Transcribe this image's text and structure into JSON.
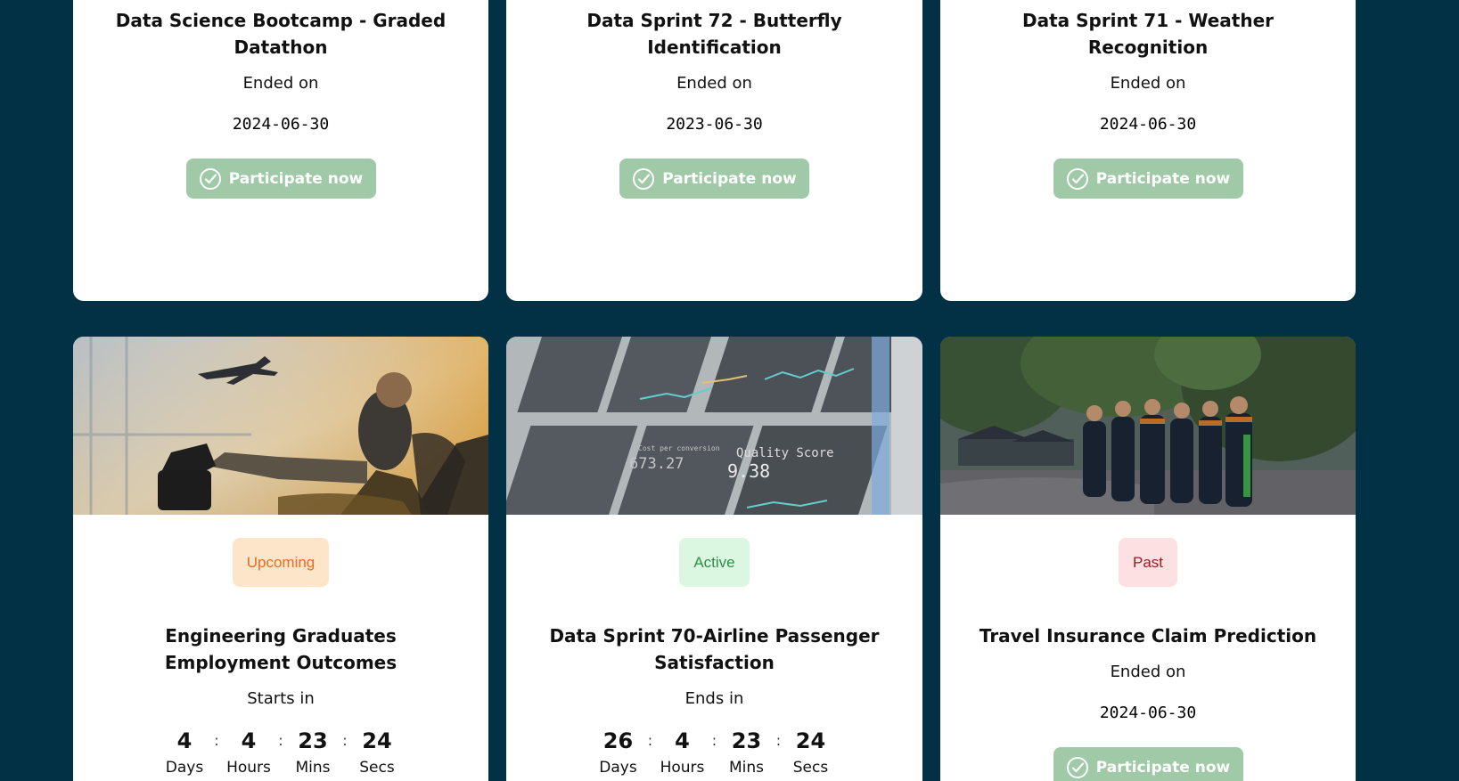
{
  "top_row": [
    {
      "title": "Data Science Bootcamp - Graded Datathon",
      "label": "Ended on",
      "date": "2024-06-30",
      "button": "Participate now"
    },
    {
      "title": "Data Sprint 72 - Butterfly Identification",
      "label": "Ended on",
      "date": "2023-06-30",
      "button": "Participate now"
    },
    {
      "title": "Data Sprint 71 - Weather Recognition",
      "label": "Ended on",
      "date": "2024-06-30",
      "button": "Participate now"
    }
  ],
  "bottom_row": [
    {
      "badge": "Upcoming",
      "title": "Engineering Graduates Employment Outcomes",
      "label": "Starts in",
      "countdown": {
        "days": "4",
        "hours": "4",
        "mins": "23",
        "secs": "24",
        "days_label": "Days",
        "hours_label": "Hours",
        "mins_label": "Mins",
        "secs_label": "Secs"
      }
    },
    {
      "badge": "Active",
      "title": "Data Sprint 70-Airline Passenger Satisfaction",
      "label": "Ends in",
      "countdown": {
        "days": "26",
        "hours": "4",
        "mins": "23",
        "secs": "24",
        "days_label": "Days",
        "hours_label": "Hours",
        "mins_label": "Mins",
        "secs_label": "Secs"
      }
    },
    {
      "badge": "Past",
      "title": "Travel Insurance Claim Prediction",
      "label": "Ended on",
      "date": "2024-06-30",
      "button": "Participate now"
    }
  ],
  "image_text": {
    "quality_score": "Quality Score",
    "score": "9.38",
    "cost_per_conversion": "Cost per conversion",
    "cost": "673.27"
  },
  "colors": {
    "background": "#023045",
    "button": "#9fc9a7",
    "upcoming": "#e46e24",
    "active": "#2f8e43",
    "past": "#9b1c25"
  }
}
